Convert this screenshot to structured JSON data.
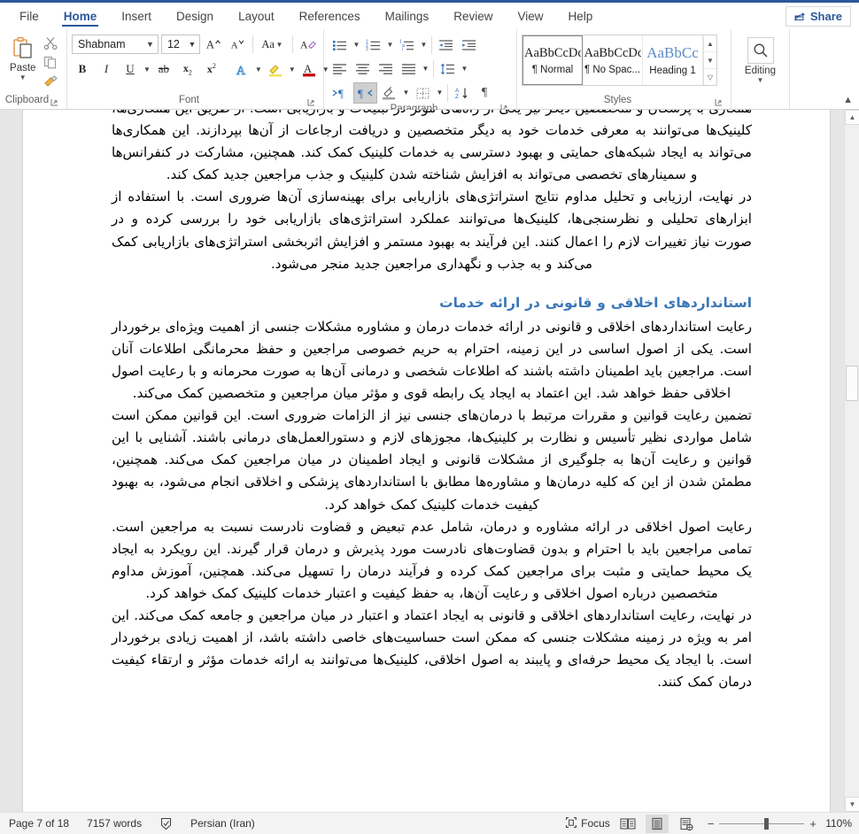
{
  "window": {
    "accent_color": "#2b579a",
    "share_label": "Share"
  },
  "tabs": [
    {
      "label": "File",
      "active": false
    },
    {
      "label": "Home",
      "active": true
    },
    {
      "label": "Insert",
      "active": false
    },
    {
      "label": "Design",
      "active": false
    },
    {
      "label": "Layout",
      "active": false
    },
    {
      "label": "References",
      "active": false
    },
    {
      "label": "Mailings",
      "active": false
    },
    {
      "label": "Review",
      "active": false
    },
    {
      "label": "View",
      "active": false
    },
    {
      "label": "Help",
      "active": false
    }
  ],
  "ribbon": {
    "clipboard": {
      "group_label": "Clipboard",
      "paste_label": "Paste",
      "cut_label": "Cut",
      "copy_label": "Copy",
      "format_painter_label": "Format Painter"
    },
    "font": {
      "group_label": "Font",
      "font_name": "Shabnam",
      "font_size": "12",
      "grow_font_label": "A",
      "shrink_font_label": "A",
      "change_case_label": "Aa",
      "clear_formatting_label": "A",
      "bold_label": "B",
      "italic_label": "I",
      "underline_label": "U",
      "strikethrough_label": "ab",
      "subscript_label": "x",
      "superscript_label": "x",
      "text_effects_label": "A",
      "highlight_label": "A",
      "font_color_label": "A"
    },
    "paragraph": {
      "group_label": "Paragraph",
      "bullets_label": "Bullets",
      "numbering_label": "Numbering",
      "multilevel_label": "Multilevel List",
      "decrease_indent_label": "Decrease Indent",
      "increase_indent_label": "Increase Indent",
      "align_left_label": "Align Left",
      "center_label": "Center",
      "align_right_label": "Align Right",
      "justify_label": "Justify",
      "line_spacing_label": "Line and Paragraph Spacing",
      "ltr_label": "Left-to-Right Text Direction",
      "rtl_label": "Right-to-Left Text Direction",
      "shading_label": "Shading",
      "borders_label": "Borders",
      "sort_label": "Sort",
      "show_marks_label": "Show/Hide"
    },
    "styles": {
      "group_label": "Styles",
      "items": [
        {
          "preview": "AaBbCcDc",
          "name": "¶ Normal",
          "selected": true
        },
        {
          "preview": "AaBbCcDc",
          "name": "¶ No Spac...",
          "selected": false
        },
        {
          "preview": "AaBbCс",
          "name": "Heading 1",
          "selected": false
        }
      ]
    },
    "editing": {
      "group_label": "",
      "button_label": "Editing"
    }
  },
  "document": {
    "heading": "استانداردهای اخلاقی و قانونی در ارائه خدمات",
    "paragraphs": [
      "همکاری با پزشکان و متخصصین دیگر نیز یکی از راه‌های مؤثر در تبلیغات و بازاریابی است. از طریق این همکاری‌ها، کلینیک‌ها می‌توانند به معرفی خدمات خود به دیگر متخصصین و دریافت ارجاعات از آن‌ها بپردازند. این همکاری‌ها می‌تواند به ایجاد شبکه‌های حمایتی و بهبود دسترسی به خدمات کلینیک کمک کند. همچنین، مشارکت در کنفرانس‌ها و سمینارهای تخصصی می‌تواند به افزایش شناخته شدن کلینیک و جذب مراجعین جدید کمک کند.",
      "در نهایت، ارزیابی و تحلیل مداوم نتایج استراتژی‌های بازاریابی برای بهینه‌سازی آن‌ها ضروری است. با استفاده از ابزارهای تحلیلی و نظرسنجی‌ها، کلینیک‌ها می‌توانند عملکرد استراتژی‌های بازاریابی خود را بررسی کرده و در صورت نیاز تغییرات لازم را اعمال کنند. این فرآیند به بهبود مستمر و افزایش اثربخشی استراتژی‌های بازاریابی کمک می‌کند و به جذب و نگهداری مراجعین جدید منجر می‌شود."
    ],
    "paragraphs_after_heading": [
      "رعایت استانداردهای اخلاقی و قانونی در ارائه خدمات درمان و مشاوره مشکلات جنسی از اهمیت ویژه‌ای برخوردار است. یکی از اصول اساسی در این زمینه، احترام به حریم خصوصی مراجعین و حفظ محرمانگی اطلاعات آنان است. مراجعین باید اطمینان داشته باشند که اطلاعات شخصی و درمانی آن‌ها به صورت محرمانه و با رعایت اصول اخلاقی حفظ خواهد شد. این اعتماد به ایجاد یک رابطه قوی و مؤثر میان مراجعین و متخصصین کمک می‌کند.",
      "تضمین رعایت قوانین و مقررات مرتبط با درمان‌های جنسی نیز از الزامات ضروری است. این قوانین ممکن است شامل مواردی نظیر تأسیس و نظارت بر کلینیک‌ها، مجوزهای لازم و دستورالعمل‌های درمانی باشند. آشنایی با این قوانین و رعایت آن‌ها به جلوگیری از مشکلات قانونی و ایجاد اطمینان در میان مراجعین کمک می‌کند. همچنین، مطمئن شدن از این که کلیه درمان‌ها و مشاوره‌ها مطابق با استانداردهای پزشکی و اخلاقی انجام می‌شود، به بهبود کیفیت خدمات کلینیک کمک خواهد کرد.",
      "رعایت اصول اخلاقی در ارائه مشاوره و درمان، شامل عدم تبعیض و قضاوت نادرست نسبت به مراجعین است. تمامی مراجعین باید با احترام و بدون قضاوت‌های نادرست مورد پذیرش و درمان قرار گیرند. این رویکرد به ایجاد یک محیط حمایتی و مثبت برای مراجعین کمک کرده و فرآیند درمان را تسهیل می‌کند. همچنین، آموزش مداوم متخصصین درباره اصول اخلاقی و رعایت آن‌ها، به حفظ کیفیت و اعتبار خدمات کلینیک کمک خواهد کرد.",
      "در نهایت، رعایت استانداردهای اخلاقی و قانونی به ایجاد اعتماد و اعتبار در میان مراجعین و جامعه کمک می‌کند. این امر به ویژه در زمینه مشکلات جنسی که ممکن است حساسیت‌های خاصی داشته باشد، از اهمیت زیادی برخوردار است. با ایجاد یک محیط حرفه‌ای و پایبند به اصول اخلاقی، کلینیک‌ها می‌توانند به ارائه خدمات مؤثر و ارتقاء کیفیت درمان کمک کنند."
    ]
  },
  "statusbar": {
    "page_label": "Page 7 of 18",
    "word_count": "7157 words",
    "proofing_icon": "spelling-check-icon",
    "language": "Persian (Iran)",
    "focus_label": "Focus",
    "view_read_label": "Read Mode",
    "view_print_label": "Print Layout",
    "view_web_label": "Web Layout",
    "zoom_out_label": "−",
    "zoom_in_label": "+",
    "zoom_level": "110%"
  }
}
